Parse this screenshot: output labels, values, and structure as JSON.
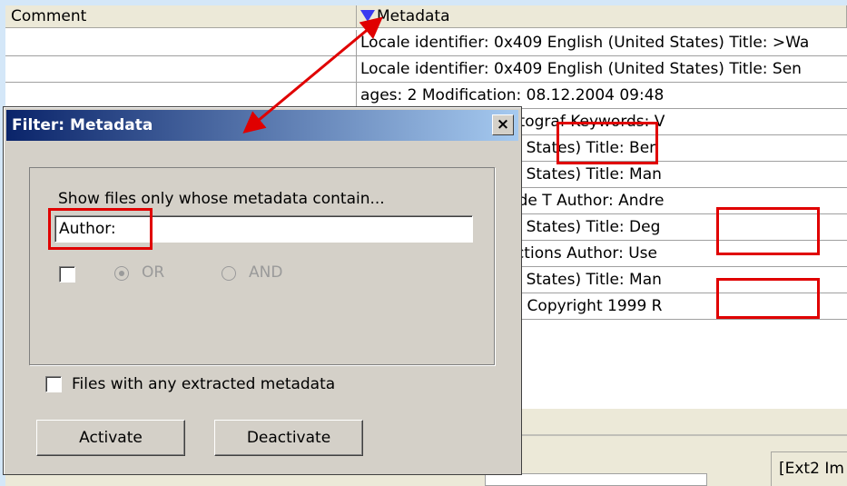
{
  "table": {
    "columns": {
      "comment": "Comment",
      "metadata": "Metadata"
    },
    "rows": [
      {
        "metadata": "Locale identifier: 0x409 English (United States) Title: >Wa"
      },
      {
        "metadata": "Locale identifier: 0x409 English (United States) Title: Sen"
      },
      {
        "metadata": "ages: 2 Modification: 08.12.2004 09:48"
      },
      {
        "metadata": "sland Author: Der Fotograf Keywords: V"
      },
      {
        "metadata": "x409 English (United States) Title: Ben"
      },
      {
        "metadata": "x409 English (United States) Title: Man"
      },
      {
        "metadata": "er Programming: Mode T Author: Andre"
      },
      {
        "metadata": "x409 English (United States) Title: Deg"
      },
      {
        "metadata": "esis Layouts - Instructions Author: Use"
      },
      {
        "metadata": "x409 English (United States) Title: Man"
      },
      {
        "metadata": "eator: dvips(k) 5.86d Copyright 1999 R"
      }
    ]
  },
  "status": {
    "text": "[Ext2 Im"
  },
  "dialog": {
    "title": "Filter: Metadata",
    "close_glyph": "×",
    "prompt": "Show files only whose metadata contain...",
    "filter_value": "Author:",
    "or_label": "OR",
    "and_label": "AND",
    "any_metadata_label": "Files with any extracted metadata",
    "activate_label": "Activate",
    "deactivate_label": "Deactivate"
  },
  "colors": {
    "highlight": "#e00000",
    "titlebar_start": "#0a246a",
    "titlebar_end": "#a6caf0"
  }
}
